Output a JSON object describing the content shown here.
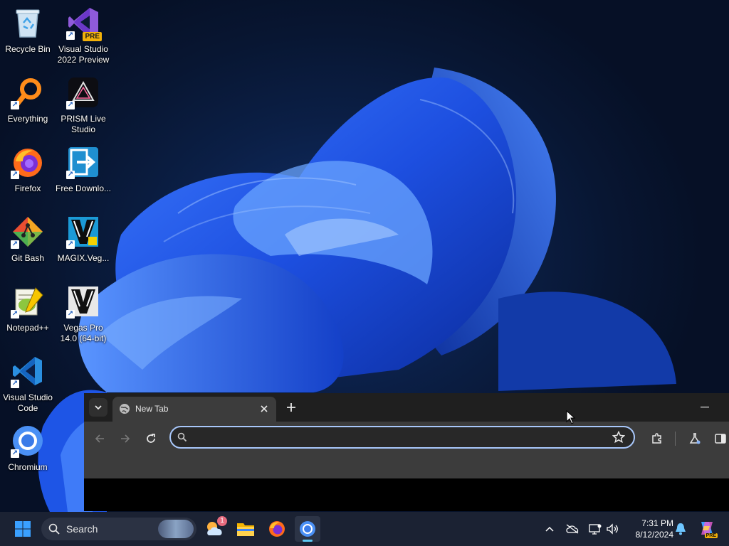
{
  "desktop": {
    "icons": [
      {
        "label": "Recycle Bin",
        "icon": "recycle-bin-icon"
      },
      {
        "label": "Visual Studio 2022 Preview",
        "icon": "visual-studio-preview-icon",
        "badge": "PRE"
      },
      {
        "label": "Everything",
        "icon": "everything-search-icon"
      },
      {
        "label": "PRISM Live Studio",
        "icon": "prism-live-studio-icon"
      },
      {
        "label": "Firefox",
        "icon": "firefox-icon"
      },
      {
        "label": "Free Downlo...",
        "icon": "free-download-manager-icon"
      },
      {
        "label": "Git Bash",
        "icon": "git-bash-icon"
      },
      {
        "label": "MAGIX.Veg...",
        "icon": "magix-vegas-icon"
      },
      {
        "label": "Notepad++",
        "icon": "notepad-plus-plus-icon"
      },
      {
        "label": "Vegas Pro 14.0 (64-bit)",
        "icon": "vegas-pro-icon"
      },
      {
        "label": "Visual Studio Code",
        "icon": "vscode-icon"
      },
      {
        "label": "Chromium",
        "icon": "chromium-icon"
      }
    ]
  },
  "browser": {
    "tabs": [
      {
        "label": "New Tab",
        "active": true
      }
    ],
    "newtab_label": "+",
    "minimize_label": "—",
    "omnibox": {
      "value": "",
      "placeholder": ""
    },
    "accent": "#a8c7fa"
  },
  "taskbar": {
    "search_label": "Search",
    "pinned": [
      "widgets-icon",
      "file-explorer-icon",
      "firefox-icon",
      "chromium-icon"
    ],
    "widgets_badge": "1",
    "clock": {
      "time": "7:31 PM",
      "date": "8/12/2024"
    },
    "copilot_badge": "PRE"
  },
  "colors": {
    "taskbar_bg": "#1b2233",
    "tab_active": "#3c3c3c",
    "tabstrip_bg": "#1f1f1f",
    "omnibox_border": "#a8c7fa"
  }
}
